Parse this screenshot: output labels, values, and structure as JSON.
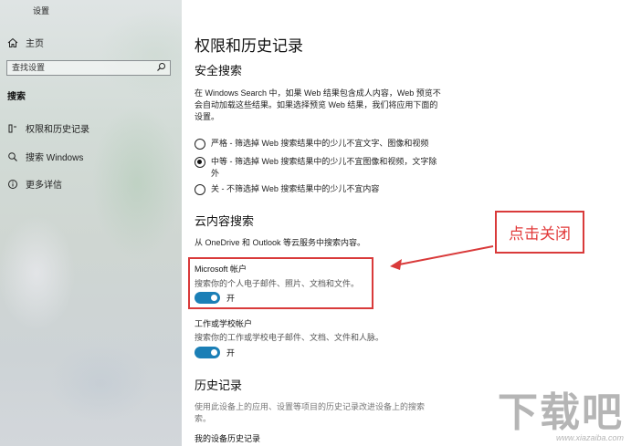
{
  "window": {
    "title": "设置"
  },
  "sidebar": {
    "home_label": "主页",
    "search_placeholder": "查找设置",
    "section_label": "搜索",
    "items": [
      {
        "label": "权限和历史记录",
        "icon": "permissions-icon"
      },
      {
        "label": "搜索 Windows",
        "icon": "search-icon"
      },
      {
        "label": "更多详信",
        "icon": "info-icon"
      }
    ]
  },
  "main": {
    "title": "权限和历史记录",
    "safe_search": {
      "heading": "安全搜索",
      "description_lines": [
        "在 Windows Search 中，如果 Web 结果包含成人内容，Web 预览不",
        "会自动加载这些结果。如果选择预览 Web 结果，我们将应用下面的",
        "设置。"
      ],
      "options": [
        {
          "lines": [
            "严格 - 筛选掉 Web 搜索结果中的少儿不宜文字、图像和视频"
          ],
          "checked": false
        },
        {
          "lines": [
            "中等 - 筛选掉 Web 搜索结果中的少儿不宜图像和视频，文字除",
            "外"
          ],
          "checked": true
        },
        {
          "lines": [
            "关 - 不筛选掉 Web 搜索结果中的少儿不宜内容"
          ],
          "checked": false
        }
      ]
    },
    "cloud_search": {
      "heading": "云内容搜索",
      "description": "从 OneDrive 和 Outlook 等云服务中搜索内容。",
      "microsoft_account": {
        "label": "Microsoft 帐户",
        "description": "搜索你的个人电子邮件、照片、文档和文件。",
        "toggle_label": "开",
        "on": true
      },
      "work_account": {
        "label": "工作或学校帐户",
        "description": "搜索你的工作或学校电子邮件、文档、文件和人脉。",
        "toggle_label": "开",
        "on": true
      }
    },
    "history": {
      "heading": "历史记录",
      "description_lines": [
        "使用此设备上的应用、设置等项目的历史记录改进设备上的搜索",
        "索。"
      ],
      "device_history_label": "我的设备历史记录"
    }
  },
  "annotation": {
    "callout_text": "点击关闭",
    "color": "#d93a3a"
  },
  "watermark": {
    "text": "下载吧",
    "url": "www.xiazaiba.com"
  }
}
